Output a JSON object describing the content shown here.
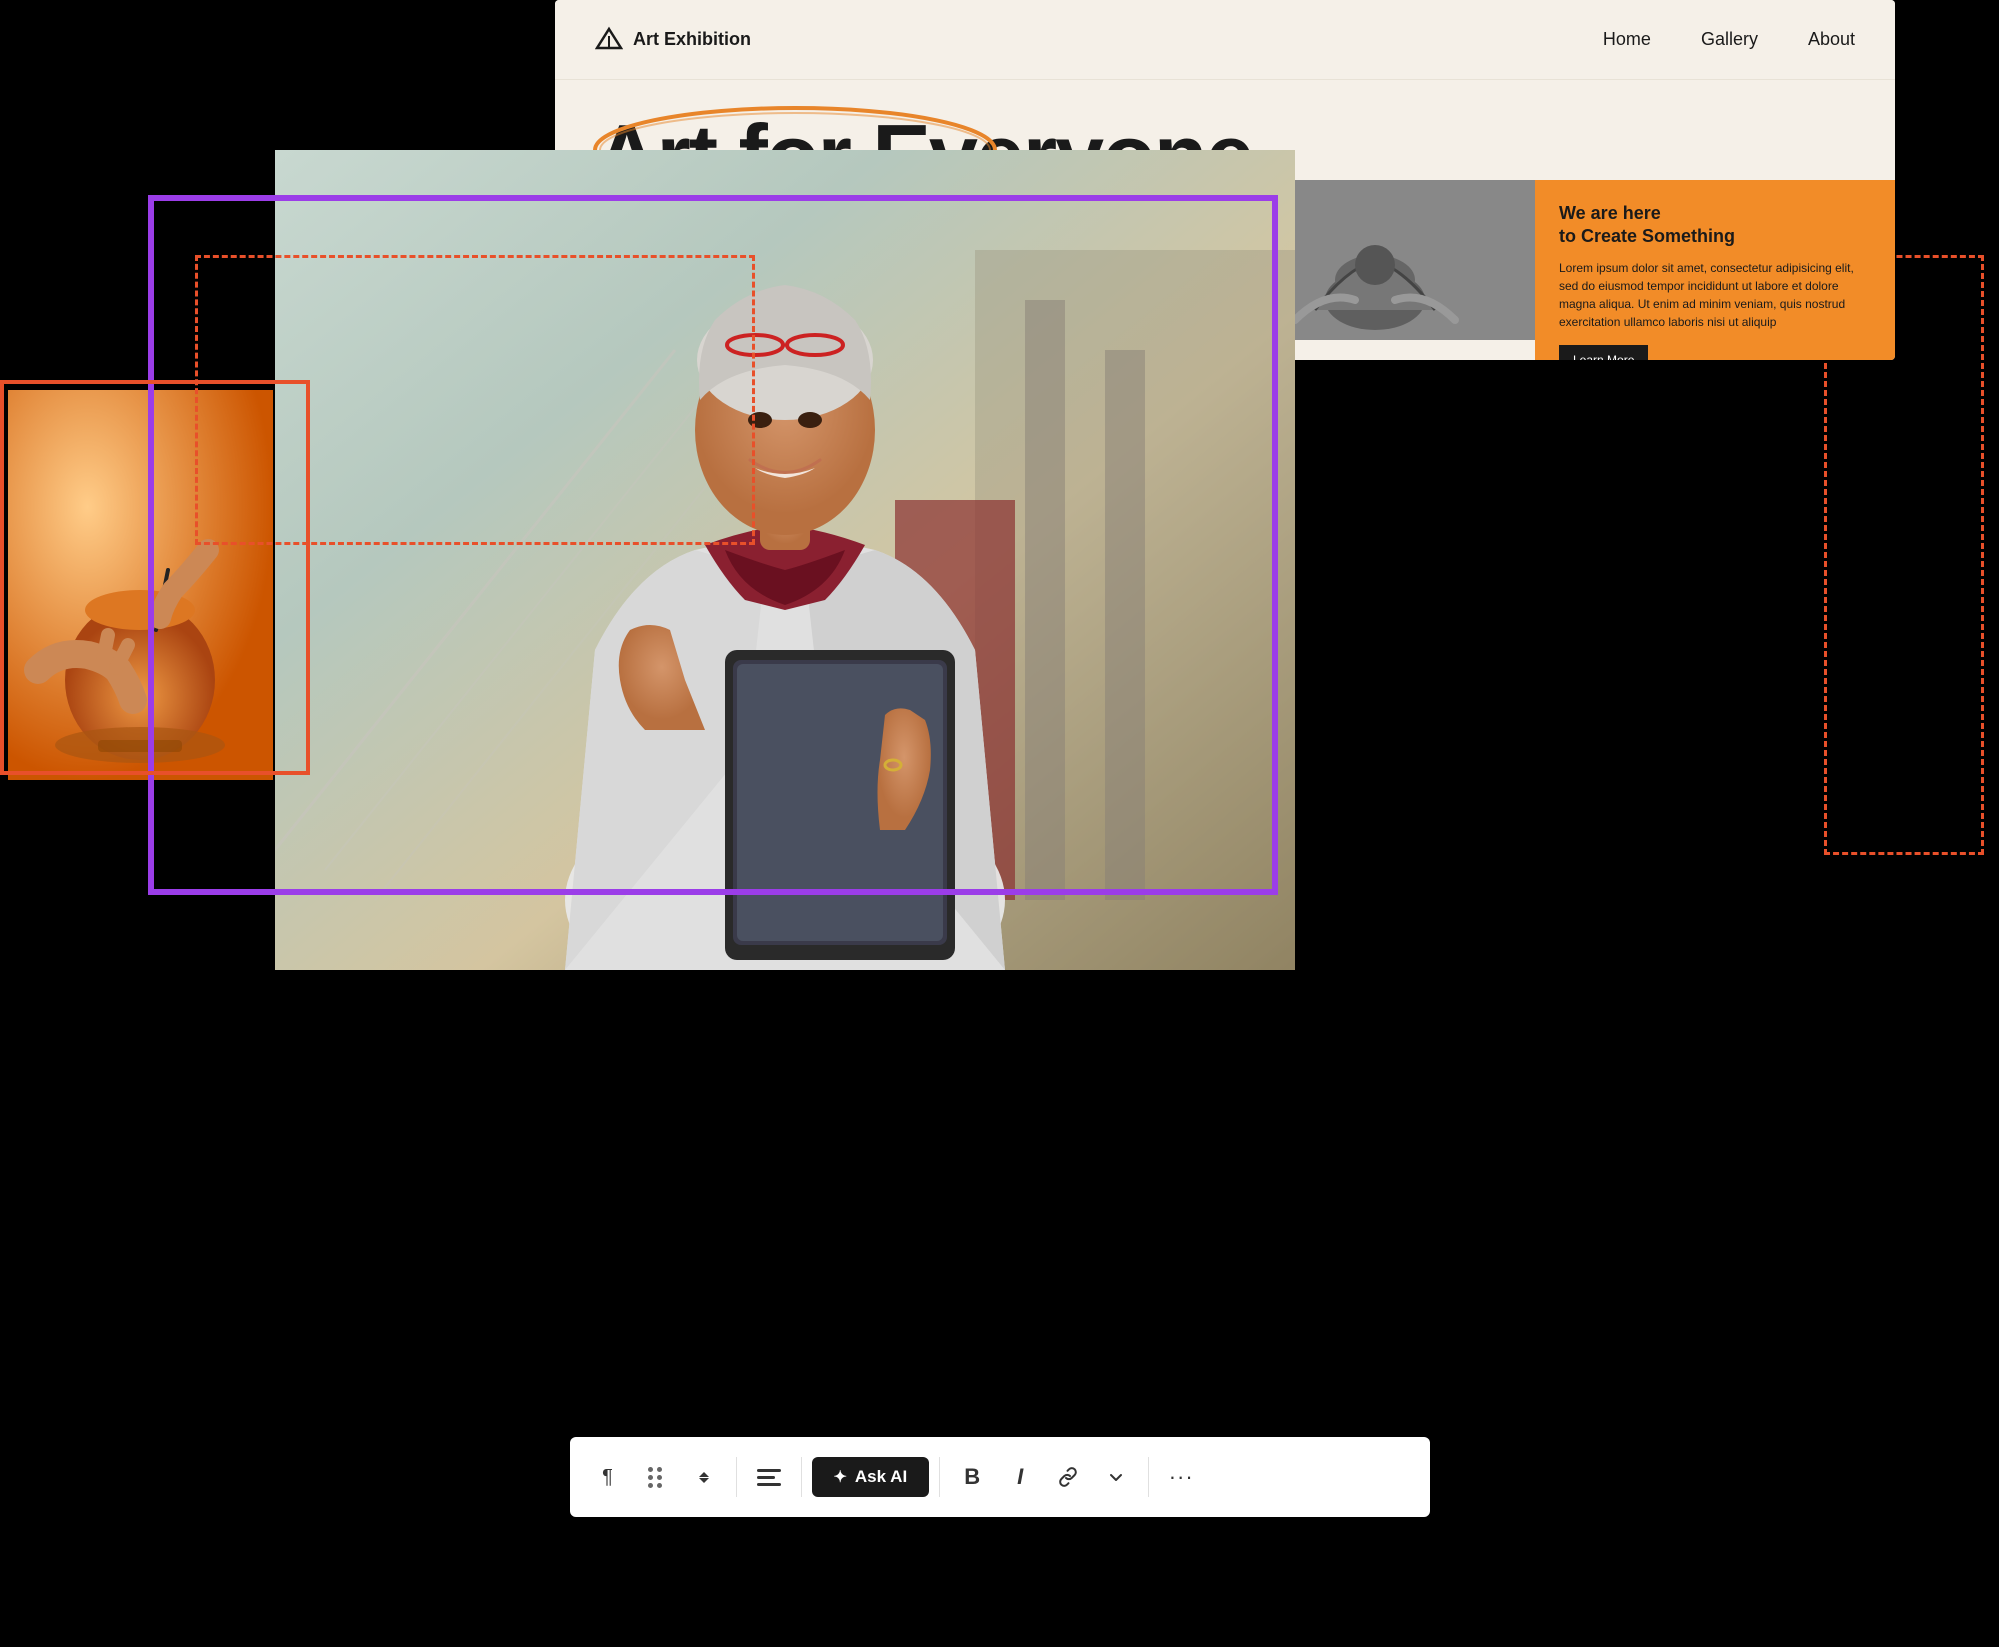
{
  "scene": {
    "background": "#000000"
  },
  "website": {
    "nav": {
      "logo_text": "Art Exhibition",
      "links": [
        "Home",
        "Gallery",
        "About"
      ]
    },
    "hero": {
      "title": "Art for Everyone"
    },
    "orange_card": {
      "title_line1": "We are here",
      "title_line2": "to Create Something",
      "body_text": "Lorem ipsum dolor sit amet, consectetur adipisicing elit, sed do eiusmod tempor incididunt ut labore et dolore magna aliqua. Ut enim ad minim veniam, quis nostrud exercitation ullamco laboris nisi ut aliquip",
      "button_label": "Learn More"
    }
  },
  "toolbar": {
    "paragraph_icon": "¶",
    "grip_icon": "⠿",
    "chevron_icon": "⌃",
    "align_icon": "☰",
    "ask_ai_label": "Ask AI",
    "bold_label": "B",
    "italic_label": "I",
    "link_label": "⊕",
    "chevron_down_label": "∨",
    "more_label": "···"
  },
  "colors": {
    "purple": "#9b3de8",
    "orange": "#f28c28",
    "orange_frame": "#e8502a",
    "black": "#1a1a1a",
    "bg_cream": "#f5f0e8"
  }
}
